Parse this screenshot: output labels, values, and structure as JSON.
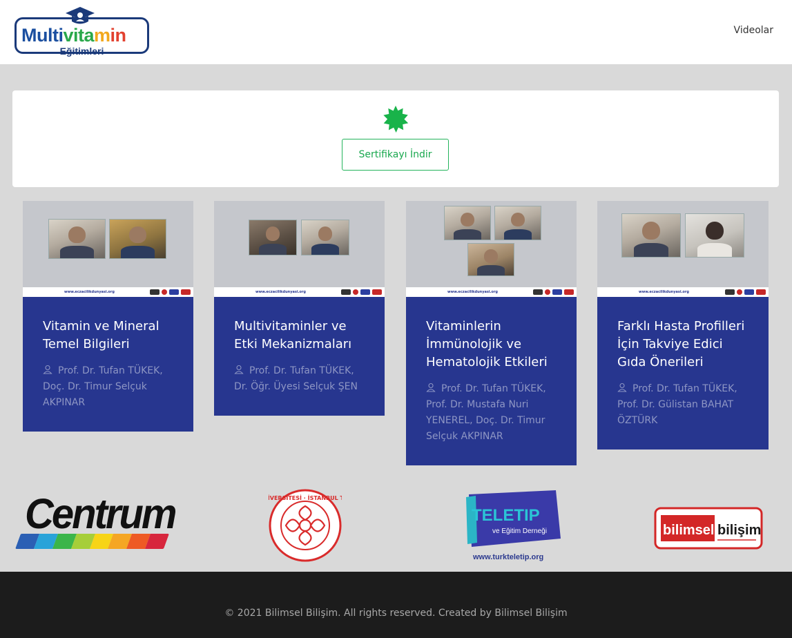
{
  "header": {
    "logo_text_parts": [
      "Multi",
      "vita",
      "m",
      "in"
    ],
    "logo_subtitle": "Eğitimleri",
    "nav": [
      {
        "label": "Videolar"
      }
    ]
  },
  "certificate": {
    "icon": "badge-check-icon",
    "button_label": "Sertifikayı İndir"
  },
  "courses": [
    {
      "title": "Vitamin ve Mineral Temel Bilgileri",
      "speakers": "Prof. Dr. Tufan TÜKEK, Doç. Dr. Timur Selçuk AKPINAR",
      "thumb_site": "www.eczacilikdunyasi.org"
    },
    {
      "title": "Multivitaminler ve Etki Mekanizmaları",
      "speakers": "Prof. Dr. Tufan TÜKEK, Dr. Öğr. Üyesi Selçuk ŞEN",
      "thumb_site": "www.eczacilikdunyasi.org"
    },
    {
      "title": "Vitaminlerin İmmünolojik ve Hematolojik Etkileri",
      "speakers": "Prof. Dr. Tufan TÜKEK, Prof. Dr. Mustafa Nuri YENEREL, Doç. Dr. Timur Selçuk AKPINAR",
      "thumb_site": "www.eczacilikdunyasi.org"
    },
    {
      "title": "Farklı Hasta Profilleri İçin Takviye Edici Gıda Önerileri",
      "speakers": "Prof. Dr. Tufan TÜKEK, Prof. Dr. Gülistan BAHAT ÖZTÜRK",
      "thumb_site": "www.eczacilikdunyasi.org"
    }
  ],
  "sponsors": {
    "centrum": "Centrum",
    "istanbul_university_seal": "İSTANBUL ÜNİVERSİTESİ · İSTANBUL TIP FAKÜLTESİ",
    "teletip_name": "TELETIP",
    "teletip_sub": "ve Eğitim Derneği",
    "teletip_url": "www.turkteletip.org",
    "bilimsel_1": "bilimsel",
    "bilimsel_2": "bilişim"
  },
  "footer": {
    "copyright": "© 2021 Bilimsel Bilişim. All rights reserved. Created by Bilimsel Bilişim"
  },
  "colors": {
    "card_blue": "#27368f",
    "accent_green": "#1aa84f",
    "page_bg": "#d9d9d9",
    "footer_bg": "#1c1c1c"
  }
}
